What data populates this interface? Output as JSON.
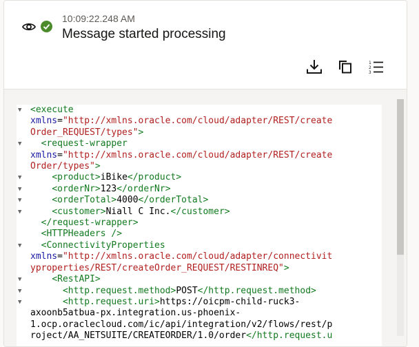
{
  "header": {
    "timestamp": "10:09:22.248 AM",
    "message": "Message started processing",
    "status_color": "#4c8a2c"
  },
  "toolbar": {
    "download_icon": "download-icon",
    "copy_icon": "copy-icon",
    "line_numbers_icon": "line-numbers-icon"
  },
  "code": {
    "lines": [
      [
        "▼",
        "<execute"
      ],
      [
        "",
        "xmlns=\"http://xmlns.oracle.com/cloud/adapter/REST/create"
      ],
      [
        "",
        "Order_REQUEST/types\">"
      ],
      [
        "▼",
        "  <request-wrapper"
      ],
      [
        "",
        "xmlns=\"http://xmlns.oracle.com/cloud/adapter/REST/create"
      ],
      [
        "",
        "Order/types\">"
      ],
      [
        "▼",
        "    <product>iBike</product>"
      ],
      [
        "▼",
        "    <orderNr>123</orderNr>"
      ],
      [
        "▼",
        "    <orderTotal>4000</orderTotal>"
      ],
      [
        "▼",
        "    <customer>Niall C Inc.</customer>"
      ],
      [
        "",
        "  </request-wrapper>"
      ],
      [
        "",
        "  <HTTPHeaders />"
      ],
      [
        "▼",
        "  <ConnectivityProperties"
      ],
      [
        "",
        "xmlns=\"http://xmlns.oracle.com/cloud/adapter/connectivit"
      ],
      [
        "",
        "yproperties/REST/createOrder_REQUEST/RESTINREQ\">"
      ],
      [
        "▼",
        "    <RestAPI>"
      ],
      [
        "▼",
        "      <http.request.method>POST</http.request.method>"
      ],
      [
        "▼",
        "      <http.request.uri>https://oicpm-child-ruck3-"
      ],
      [
        "",
        "axoonb5atbua-px.integration.us-phoenix-"
      ],
      [
        "",
        "1.ocp.oraclecloud.com/ic/api/integration/v2/flows/rest/p"
      ],
      [
        "",
        "roject/AA_NETSUITE/CREATEORDER/1.0/order</http.request.u"
      ]
    ]
  },
  "scrollbar": {
    "position": 0
  }
}
